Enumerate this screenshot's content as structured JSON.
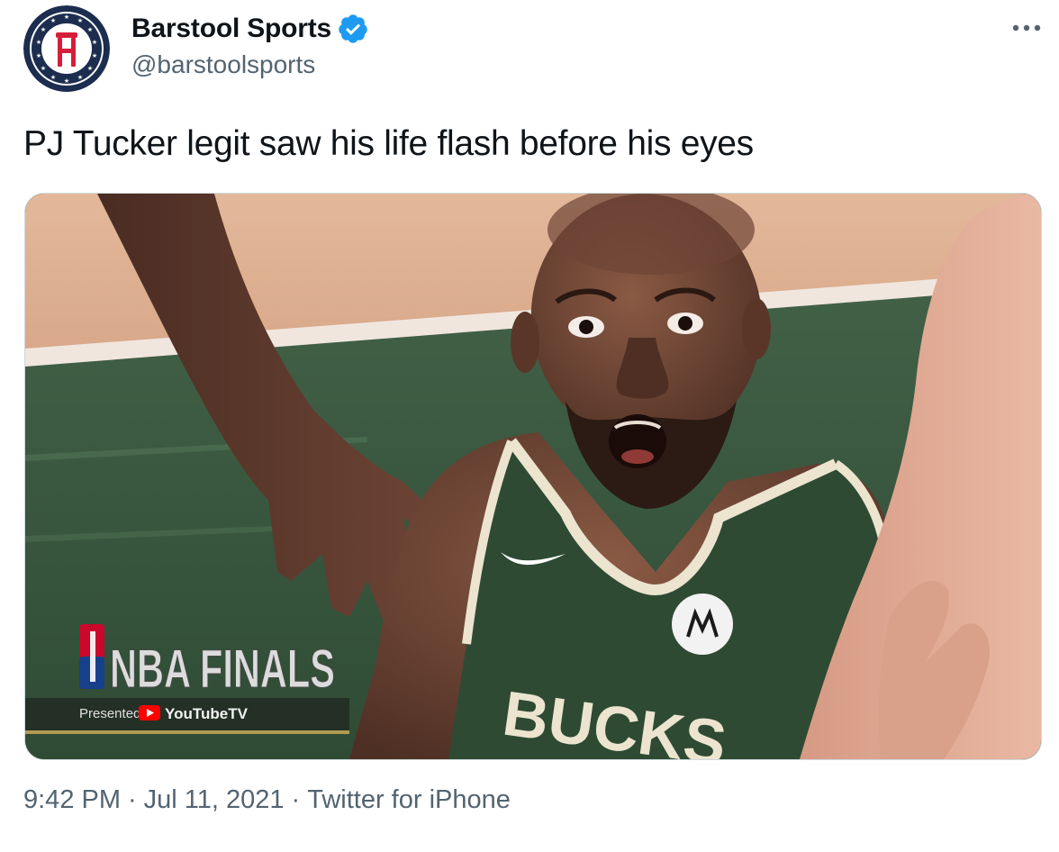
{
  "author": {
    "display_name": "Barstool Sports",
    "handle": "@barstoolsports",
    "verified_icon": "verified-badge-icon",
    "avatar_icon": "barstool-logo-icon"
  },
  "tweet": {
    "text": "PJ Tucker legit saw his life flash before his eyes"
  },
  "media": {
    "broadcast_logo_text": "NBA FINALS",
    "presented_by": "Presented by",
    "sponsor": "YouTubeTV",
    "jersey_text": "BUCKS"
  },
  "meta": {
    "time": "9:42 PM",
    "separator": "·",
    "date": "Jul 11, 2021",
    "source": "Twitter for iPhone"
  },
  "colors": {
    "text": "#0f1419",
    "secondary": "#536471",
    "verified": "#1d9bf0",
    "avatar_bg": "#1c2d4f",
    "jersey_green": "#2e4a33"
  },
  "more_icon": "more-options-icon"
}
